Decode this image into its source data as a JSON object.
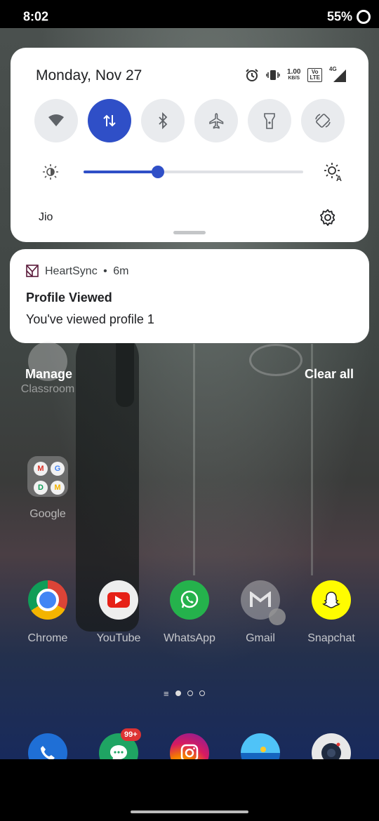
{
  "status_bar": {
    "time": "8:02",
    "battery": "55%"
  },
  "quick_settings": {
    "date": "Monday, Nov 27",
    "net_speed_value": "1.00",
    "net_speed_unit": "KB/S",
    "volte_top": "Vo",
    "volte_bottom": "LTE",
    "signal_label": "4G",
    "carrier": "Jio",
    "brightness_level": 0.34,
    "accent_color": "#2f4fc7",
    "tiles": [
      {
        "name": "wifi",
        "icon": "wifi-icon",
        "active": false
      },
      {
        "name": "mobile-data",
        "icon": "mobile-data-icon",
        "active": true
      },
      {
        "name": "bluetooth",
        "icon": "bluetooth-icon",
        "active": false
      },
      {
        "name": "airplane-mode",
        "icon": "airplane-icon",
        "active": false
      },
      {
        "name": "flashlight",
        "icon": "flashlight-icon",
        "active": false
      },
      {
        "name": "auto-rotate",
        "icon": "rotate-icon",
        "active": false
      }
    ]
  },
  "notification": {
    "app_name": "HeartSync",
    "separator": "•",
    "time_ago": "6m",
    "title": "Profile Viewed",
    "body": "You've viewed profile 1"
  },
  "shade_actions": {
    "manage": "Manage",
    "clear_all": "Clear all"
  },
  "home": {
    "ghost_app_label": "Classroom",
    "folder_label": "Google",
    "folder_letters": [
      "M",
      "G",
      "D",
      "M"
    ],
    "apps": [
      "Chrome",
      "YouTube",
      "WhatsApp",
      "Gmail",
      "Snapchat"
    ],
    "page_indicator_menu": "≡",
    "dock_badge": "99+"
  }
}
